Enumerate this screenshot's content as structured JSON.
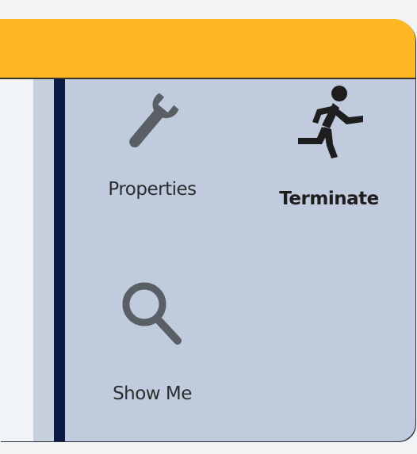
{
  "ribbon": {
    "actions": [
      {
        "id": "properties",
        "label": "Properties",
        "icon": "wrench-icon",
        "bold": false
      },
      {
        "id": "terminate",
        "label": "Terminate",
        "icon": "running-person-icon",
        "bold": true
      },
      {
        "id": "show_me",
        "label": "Show Me",
        "icon": "magnifier-icon",
        "bold": false
      }
    ]
  },
  "colors": {
    "header": "#fdb823",
    "panel": "#c0cbdd",
    "divider": "#0b1a45",
    "icon": "#5a5f66",
    "icon_dark": "#1e1e1e"
  }
}
